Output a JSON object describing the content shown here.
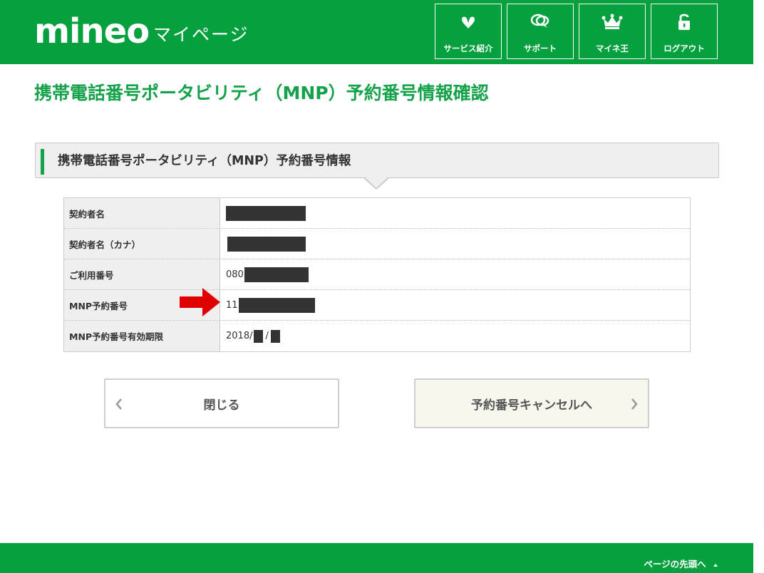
{
  "header": {
    "logo": "mineo",
    "logo_sub": "マイページ",
    "nav": [
      {
        "label": "サービス紹介",
        "icon": "heart-leaf-icon"
      },
      {
        "label": "サポート",
        "icon": "speech-bubbles-icon"
      },
      {
        "label": "マイネ王",
        "icon": "crown-icon"
      },
      {
        "label": "ログアウト",
        "icon": "unlock-icon"
      }
    ]
  },
  "page_title": "携帯電話番号ポータビリティ（MNP）予約番号情報確認",
  "section_title": "携帯電話番号ポータビリティ（MNP）予約番号情報",
  "rows": [
    {
      "label": "契約者名",
      "value_prefix": ""
    },
    {
      "label": "契約者名（カナ）",
      "value_prefix": ""
    },
    {
      "label": "ご利用番号",
      "value_prefix": "080"
    },
    {
      "label": "MNP予約番号",
      "value_prefix": "11"
    },
    {
      "label": "MNP予約番号有効期限",
      "value_prefix": "2018/",
      "value_mid": "/"
    }
  ],
  "buttons": {
    "close": "閉じる",
    "cancel": "予約番号キャンセルへ"
  },
  "footer": {
    "to_top": "ページの先頭へ"
  },
  "colors": {
    "brand_green": "#06a03e",
    "title_green": "#14a24a",
    "arrow_red": "#e00000",
    "redaction": "#333333"
  }
}
